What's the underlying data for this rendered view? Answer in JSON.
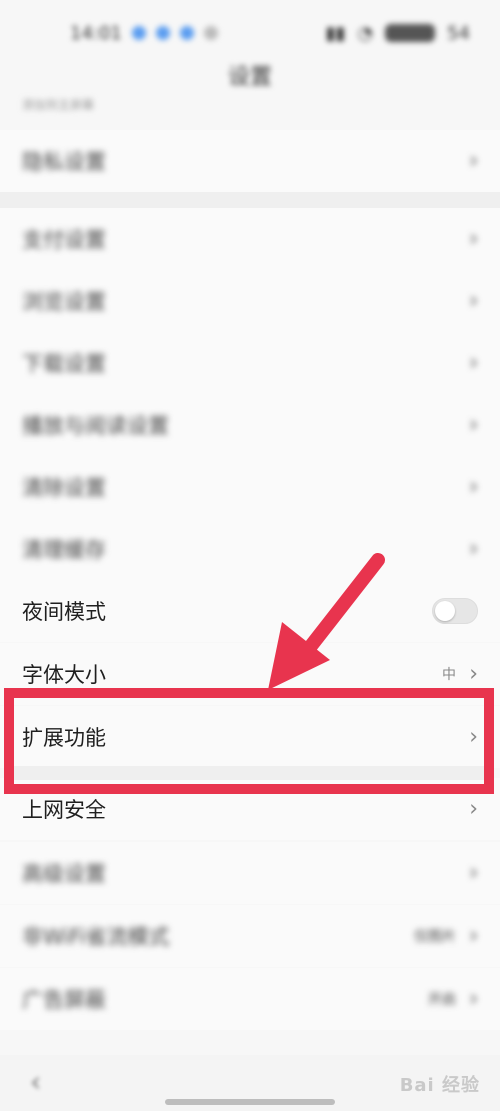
{
  "status_bar": {
    "time": "14:01",
    "battery": "54"
  },
  "header": {
    "title": "设置",
    "hint": "添加到主屏幕"
  },
  "settings": {
    "rows": [
      {
        "label": "隐私设置",
        "blurred": true
      },
      {
        "label": "支付设置",
        "blurred": true
      },
      {
        "label": "浏览设置",
        "blurred": true
      },
      {
        "label": "下载设置",
        "blurred": true
      },
      {
        "label": "播放与阅读设置",
        "blurred": true
      },
      {
        "label": "清除设置",
        "blurred": true
      },
      {
        "label": "清理缓存",
        "blurred": true
      },
      {
        "label": "夜间模式",
        "blurred": false
      },
      {
        "label": "字体大小",
        "blurred": false,
        "value": "中"
      },
      {
        "label": "扩展功能",
        "blurred": false
      },
      {
        "label": "上网安全",
        "blurred": false
      },
      {
        "label": "高级设置",
        "blurred": true
      },
      {
        "label": "非WiFi省流模式",
        "blurred": true,
        "value": "仅图片"
      },
      {
        "label": "广告屏蔽",
        "blurred": true,
        "value": "开启"
      }
    ]
  },
  "night_mode_toggle": {
    "state": "off"
  },
  "nav": {
    "back_icon": "chevron-left-icon"
  },
  "watermark": {
    "text": "Bai 经验"
  },
  "colors": {
    "highlight": "#e8344e",
    "background": "#f7f7f7"
  }
}
